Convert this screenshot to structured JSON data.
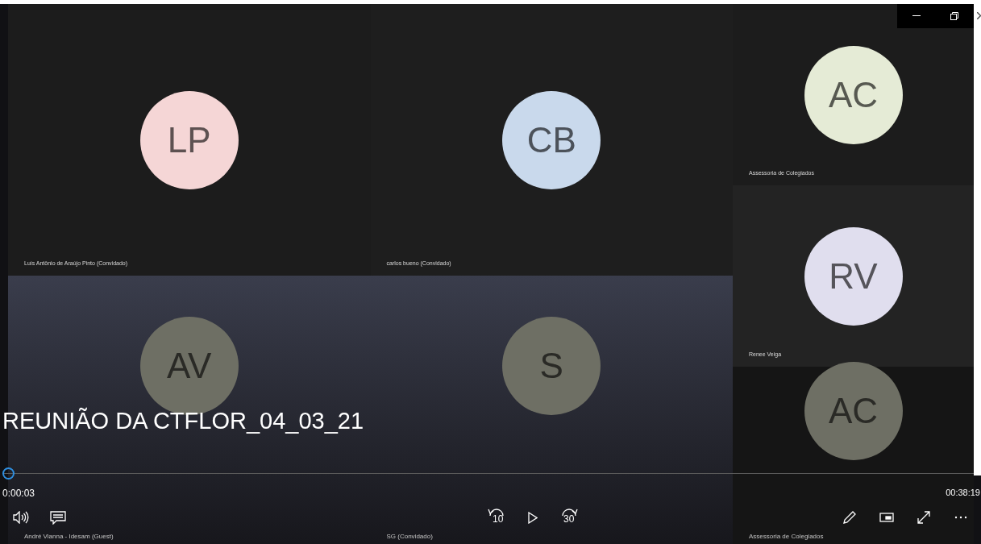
{
  "tiles": [
    {
      "initials": "LP",
      "name": "Luís Antônio de Araújo Pinto (Convidado)",
      "color": "#f5d6d6"
    },
    {
      "initials": "CB",
      "name": "carlos bueno (Convidado)",
      "color": "#c9d9ec"
    },
    {
      "initials": "AC",
      "name": "Assessoria de Colegiados",
      "color": "#e5ebd6"
    },
    {
      "initials": "RV",
      "name": "Renee Veiga",
      "color": "#e0deee"
    },
    {
      "initials": "AV",
      "name": "André Vianna - Idesam (Guest)",
      "color": "#6e6f64"
    },
    {
      "initials": "S",
      "name": "SG (Convidado)",
      "color": "#6e6f64"
    },
    {
      "initials": "AC",
      "name": "Assessoria de Colegiados",
      "color": "#6e6f64"
    }
  ],
  "player": {
    "title": "REUNIÃO DA CTFLOR_04_03_21",
    "position": "0:00:03",
    "duration": "00:38:19",
    "level": 0.0,
    "rewind_label": "10",
    "forward_label": "30"
  }
}
